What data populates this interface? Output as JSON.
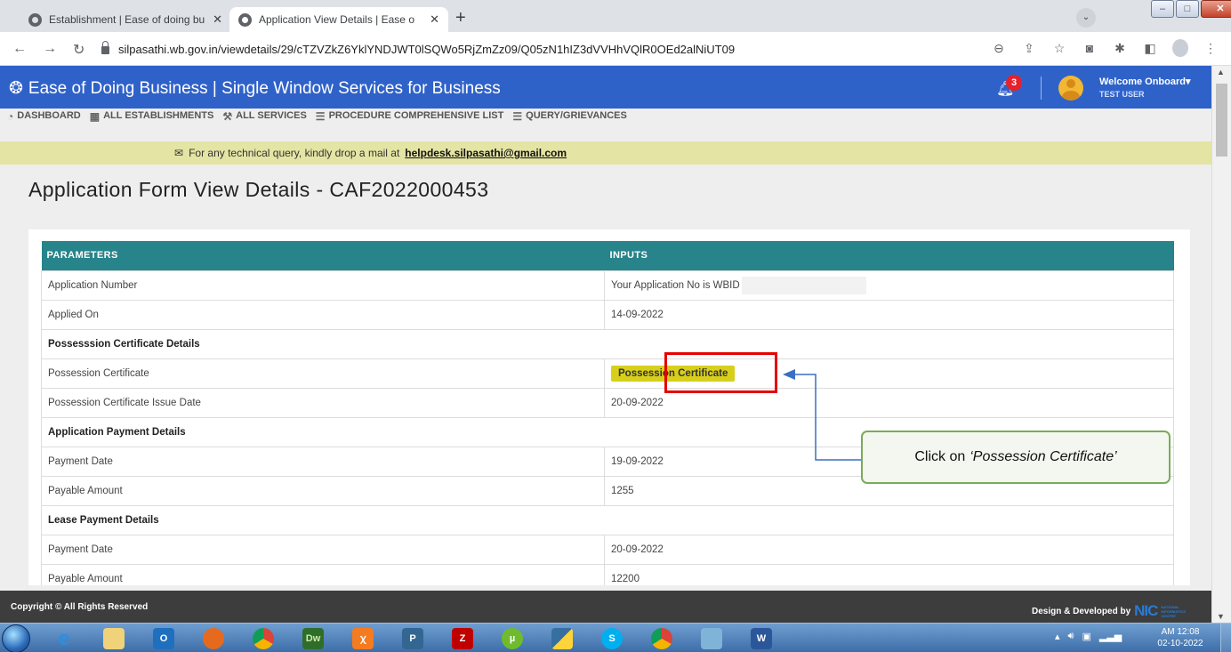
{
  "browser": {
    "tabs": [
      {
        "title": "Establishment | Ease of doing bu",
        "close": "✕"
      },
      {
        "title": "Application View Details | Ease o",
        "close": "✕"
      }
    ],
    "new_tab": "+",
    "url": "silpasathi.wb.gov.in/viewdetails/29/cTZVZkZ6YklYNDJWT0lSQWo5RjZmZz09/Q05zN1hIZ3dVVHhVQlR0OEd2alNiUT09"
  },
  "app": {
    "brand": "Ease of Doing Business | Single Window Services for Business",
    "notification_count": "3",
    "welcome": "Welcome Onboard",
    "user_name": "TEST USER",
    "nav": [
      {
        "label": "DASHBOARD",
        "icon": "dashboard-icon"
      },
      {
        "label": "ALL ESTABLISHMENTS",
        "icon": "building-icon"
      },
      {
        "label": "ALL SERVICES",
        "icon": "wrench-icon"
      },
      {
        "label": "PROCEDURE COMPREHENSIVE LIST",
        "icon": "list-icon"
      },
      {
        "label": "QUERY/GRIEVANCES",
        "icon": "list-icon"
      }
    ],
    "notice_prefix": "For any technical query, kindly drop a mail at",
    "notice_email": "helpdesk.silpasathi@gmail.com"
  },
  "page": {
    "title": "Application Form View Details - CAF2022000453",
    "table": {
      "headers": [
        "PARAMETERS",
        "INPUTS"
      ],
      "rows": [
        {
          "param": "Application Number",
          "value": "Your Application No is WBID"
        },
        {
          "param": "Applied On",
          "value": "14-09-2022"
        },
        {
          "section": "Possesssion Certificate Details"
        },
        {
          "param": "Possession Certificate",
          "value": "Possession Certificate"
        },
        {
          "param": "Possession Certificate Issue Date",
          "value": "20-09-2022"
        },
        {
          "section": "Application Payment Details"
        },
        {
          "param": "Payment Date",
          "value": "19-09-2022"
        },
        {
          "param": "Payable Amount",
          "value": "1255"
        },
        {
          "section": "Lease Payment Details"
        },
        {
          "param": "Payment Date",
          "value": "20-09-2022"
        },
        {
          "param": "Payable Amount",
          "value": "12200"
        }
      ]
    },
    "callout": {
      "prefix": "Click on",
      "emphasis": "‘Possession Certificate’"
    }
  },
  "footer": {
    "copyright": "Copyright © All Rights Reserved",
    "developed_by": "Design & Developed by",
    "nic_logo": "NIC",
    "nic_sub": "NATIONAL INFORMATICS CENTRE"
  },
  "taskbar": {
    "clock_time": "AM 12:08",
    "clock_date": "02-10-2022"
  },
  "colors": {
    "app_header": "#2f62c9",
    "table_header": "#26848a",
    "highlight_button": "#d8cf1c",
    "annotation_box": "#e60000",
    "callout_border": "#7bab5a"
  }
}
